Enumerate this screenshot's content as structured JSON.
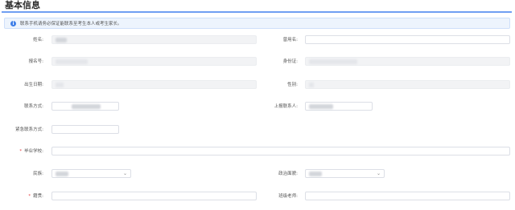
{
  "section": {
    "title": "基本信息"
  },
  "notice": {
    "text": "联系手机请务必保证能联系至考生本人或考生家长。"
  },
  "fields": {
    "name": {
      "label": "姓名:"
    },
    "former_name": {
      "label": "曾用名:",
      "value": ""
    },
    "exam_no": {
      "label": "报名号:"
    },
    "id_card": {
      "label": "身份证:"
    },
    "birth": {
      "label": "出生日期:"
    },
    "gender": {
      "label": "性别:"
    },
    "contact": {
      "label": "联系方式:"
    },
    "emergency_person": {
      "label": "上报联系人:"
    },
    "emergency_contact": {
      "label": "紧急联系方式:",
      "value": ""
    },
    "school": {
      "label": "毕业学校:",
      "value": ""
    },
    "ethnicity": {
      "label": "民族:"
    },
    "political": {
      "label": "政治面貌:"
    },
    "origin": {
      "label": "籍贯:",
      "value": ""
    },
    "teacher": {
      "label": "班级老师:",
      "value": ""
    }
  },
  "colors": {
    "accent": "#6f9ef2",
    "required": "#e5393b",
    "notice_bg": "#edf4fd"
  },
  "icons": {
    "notice": "info-icon",
    "select": "chevron-down-icon"
  }
}
